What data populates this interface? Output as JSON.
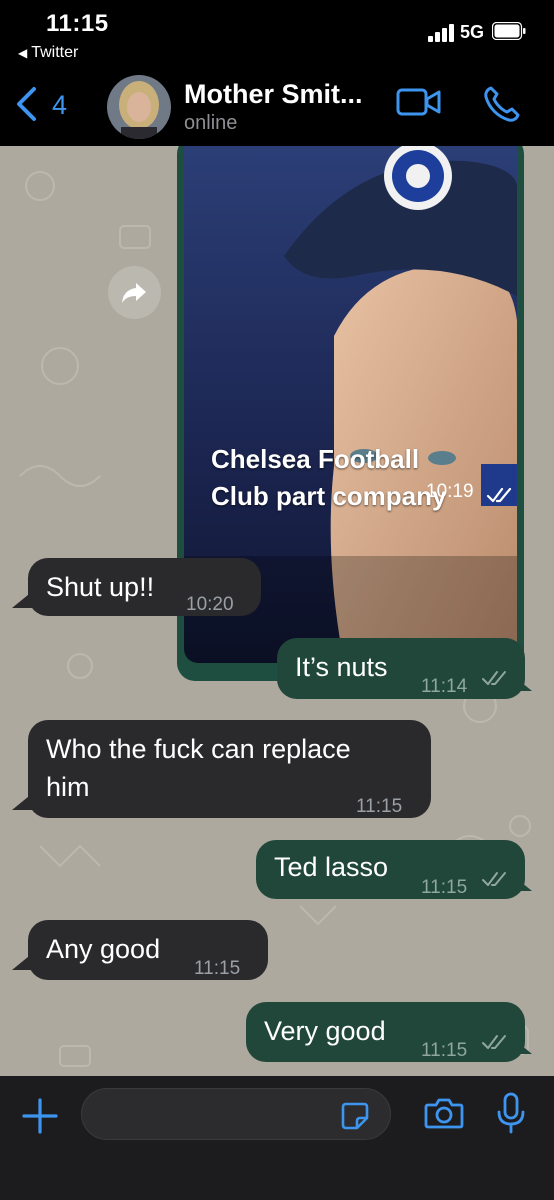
{
  "status_bar": {
    "time": "11:15",
    "back_app": "Twitter",
    "network": "5G"
  },
  "header": {
    "back_count": "4",
    "contact_name": "Mother Smit...",
    "contact_status": "online"
  },
  "messages": [
    {
      "direction": "out",
      "type": "image",
      "caption_line1": "Chelsea Football",
      "caption_line2": "Club part company",
      "time": "10:19",
      "ticks": "read"
    },
    {
      "direction": "in",
      "text": "Shut up!!",
      "time": "10:20"
    },
    {
      "direction": "out",
      "text": "It’s nuts",
      "time": "11:14",
      "ticks": "read"
    },
    {
      "direction": "in",
      "text_line1": "Who the fuck can replace",
      "text_line2": "him",
      "time": "11:15"
    },
    {
      "direction": "out",
      "text": "Ted lasso",
      "time": "11:15",
      "ticks": "read"
    },
    {
      "direction": "in",
      "text": "Any good",
      "time": "11:15"
    },
    {
      "direction": "out",
      "text": "Very good",
      "time": "11:15",
      "ticks": "read"
    }
  ],
  "colors": {
    "accent": "#3d95f0",
    "outgoing_bubble": "#21473b",
    "incoming_bubble": "#2a2a2c",
    "chat_background": "#ada99f"
  },
  "icons": {
    "header": [
      "chevron-left-icon",
      "video-camera-icon",
      "phone-icon"
    ],
    "input": [
      "plus-icon",
      "sticker-icon",
      "camera-icon",
      "microphone-icon"
    ],
    "chat": [
      "forward-icon",
      "double-check-icon"
    ]
  }
}
